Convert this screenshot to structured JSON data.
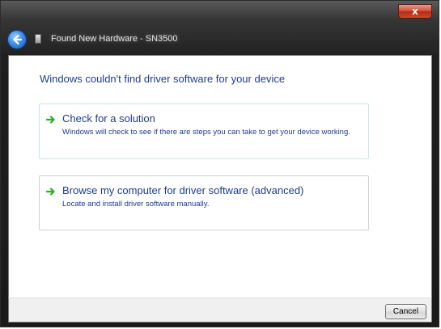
{
  "window": {
    "title": "Found New Hardware - SN3500",
    "close_glyph": "x"
  },
  "main": {
    "heading": "Windows couldn't find driver software for your device",
    "options": [
      {
        "title": "Check for a solution",
        "description": "Windows will check to see if there are steps you can take to get your device working.",
        "icon": "green-arrow-icon"
      },
      {
        "title": "Browse my computer for driver software (advanced)",
        "description": "Locate and install driver software manually.",
        "icon": "green-arrow-icon"
      }
    ]
  },
  "footer": {
    "cancel_label": "Cancel"
  },
  "colors": {
    "link_blue": "#1e3c8c",
    "arrow_green": "#2fae24",
    "close_red": "#c94a2e"
  }
}
